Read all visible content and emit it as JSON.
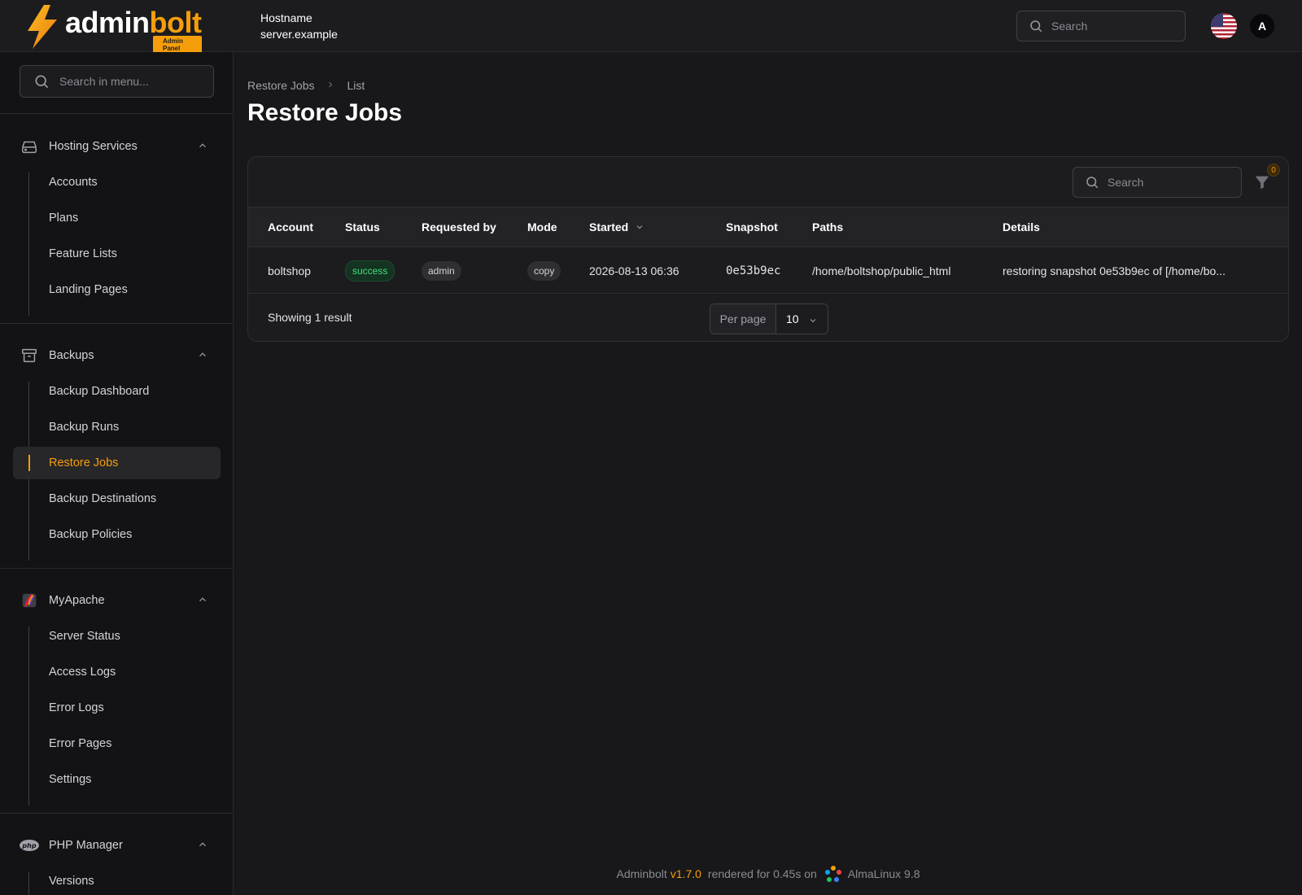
{
  "brand": {
    "name_part1": "admin",
    "name_part2": "bolt",
    "badge": "Admin Panel",
    "accent_color": "#f59e0b"
  },
  "header": {
    "hostname_label": "Hostname",
    "hostname_value": "server.example",
    "search_placeholder": "Search",
    "language_flag": "us-flag-icon",
    "avatar_initial": "A"
  },
  "sidebar": {
    "search_placeholder": "Search in menu...",
    "groups": [
      {
        "label": "Hosting Services",
        "icon": "server-icon",
        "items": [
          "Accounts",
          "Plans",
          "Feature Lists",
          "Landing Pages"
        ]
      },
      {
        "label": "Backups",
        "icon": "archive-icon",
        "items": [
          "Backup Dashboard",
          "Backup Runs",
          "Restore Jobs",
          "Backup Destinations",
          "Backup Policies"
        ],
        "active_item": "Restore Jobs"
      },
      {
        "label": "MyApache",
        "icon": "apache-feather-icon",
        "items": [
          "Server Status",
          "Access Logs",
          "Error Logs",
          "Error Pages",
          "Settings"
        ]
      },
      {
        "label": "PHP Manager",
        "icon": "php-icon",
        "items": [
          "Versions"
        ]
      }
    ]
  },
  "breadcrumb": [
    "Restore Jobs",
    "List"
  ],
  "page_title": "Restore Jobs",
  "table": {
    "search_placeholder": "Search",
    "filter_count": "0",
    "columns": [
      "Account",
      "Status",
      "Requested by",
      "Mode",
      "Started",
      "Snapshot",
      "Paths",
      "Details"
    ],
    "sorted_column": "Started",
    "rows": [
      {
        "account": "boltshop",
        "status": "success",
        "requested_by": "admin",
        "mode": "copy",
        "started": "2026-08-13 06:36",
        "snapshot": "0e53b9ec",
        "paths": "/home/boltshop/public_html",
        "details": "restoring snapshot 0e53b9ec of [/home/bo..."
      }
    ],
    "showing_text": "Showing 1 result",
    "per_page_label": "Per page",
    "per_page_value": "10"
  },
  "footer": {
    "app_name": "Adminbolt",
    "version": "v1.7.0",
    "render_text": "rendered for 0.45s on",
    "os_name": "AlmaLinux 9.8"
  }
}
